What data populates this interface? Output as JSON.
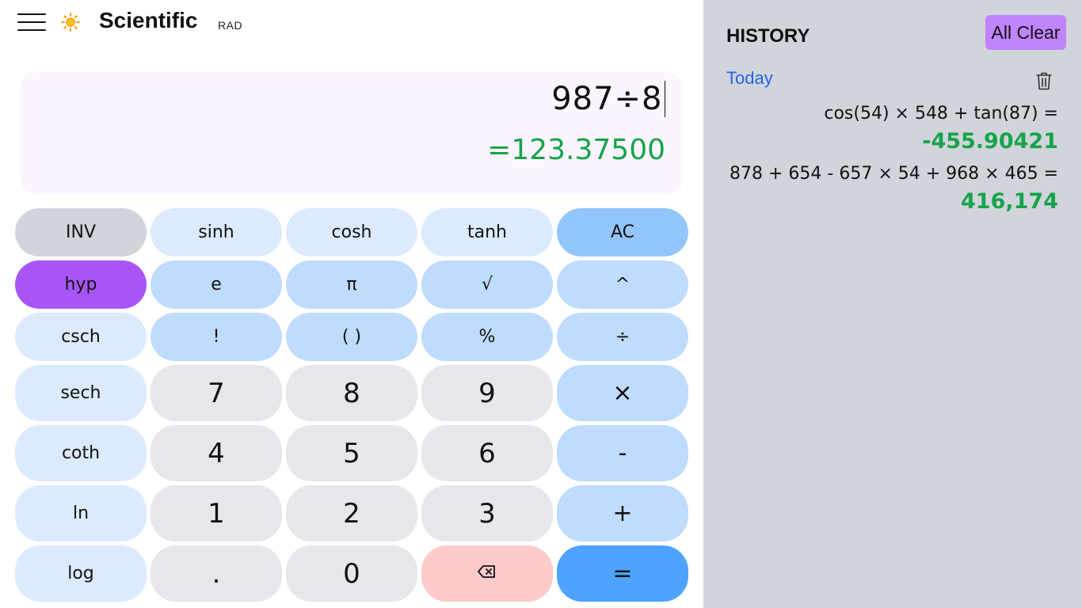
{
  "header": {
    "menu_icon": "hamburger-menu-icon",
    "theme_icon": "sun-icon",
    "title": "Scientific",
    "mode": "RAD"
  },
  "display": {
    "expression": "987÷8",
    "result": "=123.37500"
  },
  "keys": [
    {
      "name": "inv-button",
      "label": "INV",
      "style": "gray"
    },
    {
      "name": "sinh-button",
      "label": "sinh",
      "style": "fn"
    },
    {
      "name": "cosh-button",
      "label": "cosh",
      "style": "fn"
    },
    {
      "name": "tanh-button",
      "label": "tanh",
      "style": "fn"
    },
    {
      "name": "ac-button",
      "label": "AC",
      "style": "ac"
    },
    {
      "name": "hyp-button",
      "label": "hyp",
      "style": "purple"
    },
    {
      "name": "e-button",
      "label": "e",
      "style": "op"
    },
    {
      "name": "pi-button",
      "label": "π",
      "style": "op"
    },
    {
      "name": "sqrt-button",
      "label": "√",
      "style": "op"
    },
    {
      "name": "power-button",
      "label": "^",
      "style": "op"
    },
    {
      "name": "csch-button",
      "label": "csch",
      "style": "fn"
    },
    {
      "name": "factorial-button",
      "label": "!",
      "style": "op"
    },
    {
      "name": "parentheses-button",
      "label": "( )",
      "style": "op"
    },
    {
      "name": "percent-button",
      "label": "%",
      "style": "op"
    },
    {
      "name": "divide-button",
      "label": "÷",
      "style": "op"
    },
    {
      "name": "sech-button",
      "label": "sech",
      "style": "fn"
    },
    {
      "name": "digit-7-button",
      "label": "7",
      "style": "num"
    },
    {
      "name": "digit-8-button",
      "label": "8",
      "style": "num"
    },
    {
      "name": "digit-9-button",
      "label": "9",
      "style": "num"
    },
    {
      "name": "multiply-button",
      "label": "×",
      "style": "op-big"
    },
    {
      "name": "coth-button",
      "label": "coth",
      "style": "fn"
    },
    {
      "name": "digit-4-button",
      "label": "4",
      "style": "num"
    },
    {
      "name": "digit-5-button",
      "label": "5",
      "style": "num"
    },
    {
      "name": "digit-6-button",
      "label": "6",
      "style": "num"
    },
    {
      "name": "subtract-button",
      "label": "-",
      "style": "op-big"
    },
    {
      "name": "ln-button",
      "label": "ln",
      "style": "fn"
    },
    {
      "name": "digit-1-button",
      "label": "1",
      "style": "num"
    },
    {
      "name": "digit-2-button",
      "label": "2",
      "style": "num"
    },
    {
      "name": "digit-3-button",
      "label": "3",
      "style": "num"
    },
    {
      "name": "add-button",
      "label": "+",
      "style": "op-big"
    },
    {
      "name": "log-button",
      "label": "log",
      "style": "fn"
    },
    {
      "name": "decimal-button",
      "label": ".",
      "style": "num"
    },
    {
      "name": "digit-0-button",
      "label": "0",
      "style": "num"
    },
    {
      "name": "backspace-button",
      "label": "",
      "style": "back",
      "icon": "backspace-icon"
    },
    {
      "name": "equals-button",
      "label": "=",
      "style": "eq"
    }
  ],
  "history": {
    "title": "HISTORY",
    "all_clear_label": "All Clear",
    "day_label": "Today",
    "trash_icon": "trash-icon",
    "entries": [
      {
        "expression": "cos(54) × 548 + tan(87) =",
        "result": "-455.90421"
      },
      {
        "expression": "878 + 654 - 657 × 54 + 968 × 465 =",
        "result": "416,174"
      }
    ]
  },
  "colors": {
    "display_bg": "#fbf5ff",
    "result_green": "#16a34a",
    "history_bg": "#d1d5db",
    "accent_purple": "#a855f7",
    "all_clear_purple": "#c084fc",
    "equals_blue": "#4da3ff",
    "today_blue": "#2563eb"
  }
}
